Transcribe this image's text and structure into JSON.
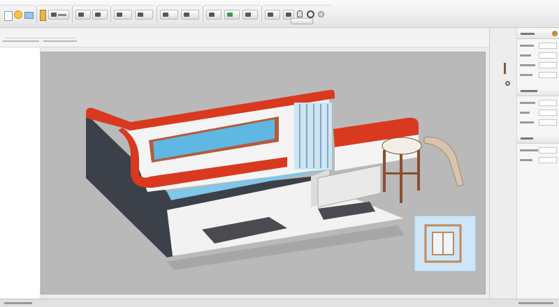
{
  "toolbar": {
    "groups": [
      {
        "id": "file"
      },
      {
        "id": "edit"
      },
      {
        "id": "view"
      },
      {
        "id": "draw"
      },
      {
        "id": "modify"
      },
      {
        "id": "arrange"
      },
      {
        "id": "render"
      }
    ]
  },
  "viewport": {
    "background": "#b9b9b9",
    "colors": {
      "trim_red": "#d9391f",
      "wall_dark": "#3c4049",
      "wall_light": "#f2f2f2",
      "glass_blue": "#5fb7e3",
      "stool_seat": "#f4efe6",
      "stool_wood": "#8a4e33",
      "preview_blue": "#cfe6f7"
    },
    "icons": [
      "settings-gear-icon",
      "layer-icon"
    ]
  },
  "right_panel": {
    "sections": [
      "properties",
      "materials",
      "layers"
    ]
  }
}
